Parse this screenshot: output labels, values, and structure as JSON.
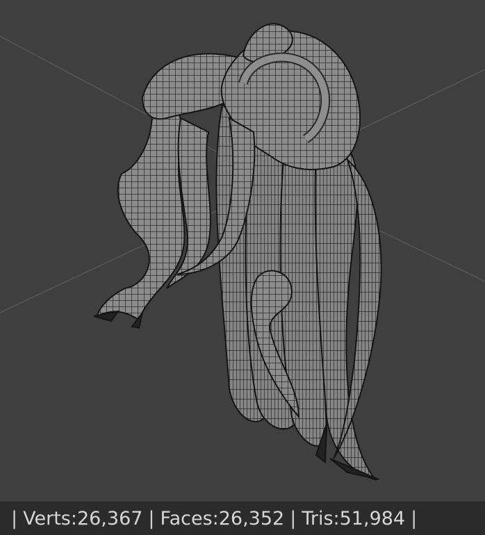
{
  "viewport": {
    "background": "#3f3f3f",
    "object": "hair-mesh-wireframe"
  },
  "statusbar": {
    "separator": "|",
    "verts": "Verts:26,367",
    "faces": "Faces:26,352",
    "tris": "Tris:51,984"
  }
}
